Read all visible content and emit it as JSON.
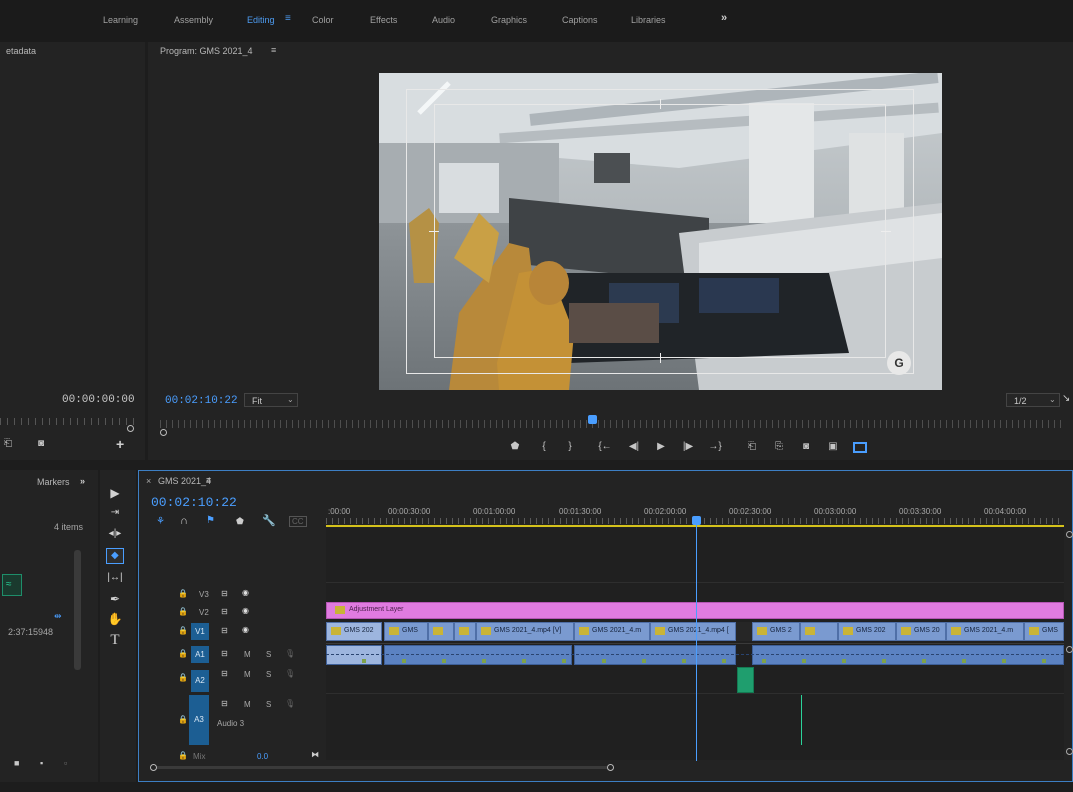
{
  "workspaces": {
    "tabs": [
      "Learning",
      "Assembly",
      "Editing",
      "Color",
      "Effects",
      "Audio",
      "Graphics",
      "Captions",
      "Libraries"
    ],
    "active": "Editing",
    "menu_icon": "hamburger-icon",
    "more_label": "»"
  },
  "metadata_panel": {
    "title": "etadata",
    "timecode": "00:00:00:00"
  },
  "program_monitor": {
    "title": "Program: GMS 2021_4",
    "menu": "≡",
    "timecode": "00:02:10:22",
    "zoom": "Fit",
    "resolution": "1/2",
    "transport_icons": [
      "marker-icon",
      "mark-in-icon",
      "mark-out-icon",
      "go-to-in-icon",
      "step-back-icon",
      "play-icon",
      "step-forward-icon",
      "go-to-out-icon",
      "insert-icon",
      "overwrite-icon",
      "export-frame-icon",
      "comparison-view-icon",
      "safe-margins-icon"
    ]
  },
  "project_panel": {
    "tab": "Markers",
    "more_label": "»",
    "items_count": "4 items",
    "clip_duration": "2:37:15948"
  },
  "tools": [
    "selection-tool-icon",
    "track-select-icon",
    "ripple-edit-icon",
    "razor-tool-icon",
    "slip-tool-icon",
    "pen-tool-icon",
    "hand-tool-icon",
    "type-tool-icon"
  ],
  "timeline": {
    "close": "×",
    "title": "GMS 2021_4",
    "menu": "≡",
    "timecode": "00:02:10:22",
    "ruler": [
      ":00:00",
      "00:00:30:00",
      "00:01:00:00",
      "00:01:30:00",
      "00:02:00:00",
      "00:02:30:00",
      "00:03:00:00",
      "00:03:30:00",
      "00:04:00:00"
    ],
    "tracks": {
      "v3": "V3",
      "v2": "V2",
      "v1": "V1",
      "a1": "A1",
      "a2": "A2",
      "a3": "A3",
      "a3_name": "Audio 3",
      "m": "M",
      "s": "S",
      "mix": "Mix",
      "mix_value": "0.0"
    },
    "adjustment_layer": "Adjustment Layer",
    "v1_clips": [
      "GMS 202",
      "GMS",
      "",
      "",
      "GMS 2021_4.mp4 [V]",
      "GMS 2021_4.m",
      "GMS 2021_4.mp4 [",
      "GMS 2",
      "",
      "GMS 202",
      "GMS 20",
      "GMS 2021_4.m",
      "GMS"
    ]
  },
  "colors": {
    "accent_blue": "#4a9eff",
    "adjustment_layer": "#e07be0",
    "video_clip": "#7a9ad0",
    "audio_clip": "#5b82c2",
    "track_target": "#1c5e93",
    "audio_keyframe": "#7fa24a"
  }
}
